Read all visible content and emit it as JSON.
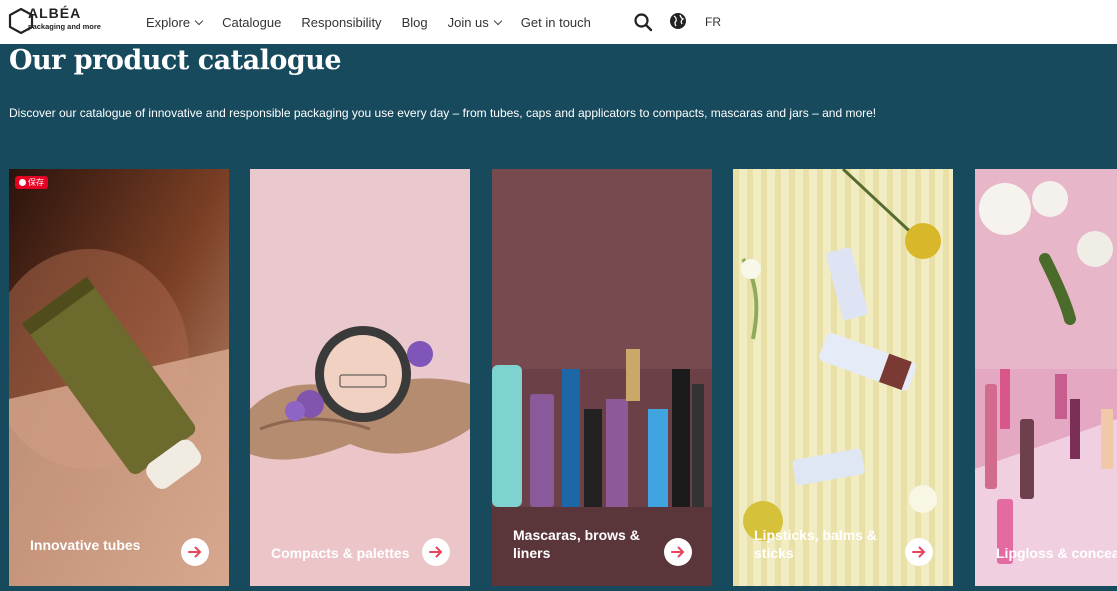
{
  "brand": {
    "name": "ALBÉA",
    "tagline": "packaging and more"
  },
  "nav": {
    "items": [
      {
        "label": "Explore",
        "has_dropdown": true
      },
      {
        "label": "Catalogue",
        "has_dropdown": false
      },
      {
        "label": "Responsibility",
        "has_dropdown": false
      },
      {
        "label": "Blog",
        "has_dropdown": false
      },
      {
        "label": "Join us",
        "has_dropdown": true
      },
      {
        "label": "Get in touch",
        "has_dropdown": false
      }
    ],
    "search_icon": "search-icon",
    "globe_icon": "globe-icon",
    "language": "FR"
  },
  "hero": {
    "title": "Our product catalogue",
    "subtitle": "Discover our catalogue of innovative and responsible packaging you use every day – from tubes, caps and applicators to compacts, mascaras and jars – and more!"
  },
  "pinterest_badge": "保存",
  "cards": [
    {
      "label": "Innovative tubes",
      "arrow_icon": "arrow-right-icon"
    },
    {
      "label": "Compacts & palettes",
      "arrow_icon": "arrow-right-icon"
    },
    {
      "label": "Mascaras, brows & liners",
      "arrow_icon": "arrow-right-icon"
    },
    {
      "label": "Lipsticks, balms & sticks",
      "arrow_icon": "arrow-right-icon"
    },
    {
      "label": "Lipgloss & concealers",
      "arrow_icon": "arrow-right-icon"
    }
  ],
  "colors": {
    "header_bg": "#ffffff",
    "page_bg": "#184a5e",
    "accent": "#e8455a",
    "pinterest": "#e60023"
  }
}
